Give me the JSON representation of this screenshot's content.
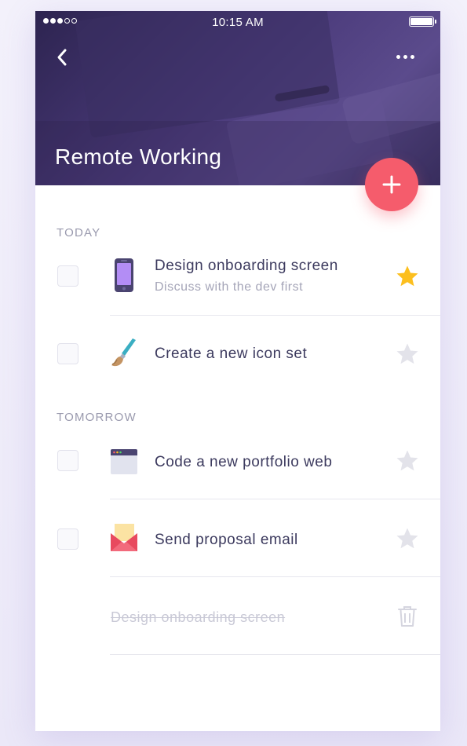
{
  "status_bar": {
    "time": "10:15 AM"
  },
  "header": {
    "title": "Remote Working"
  },
  "sections": {
    "today": "TODAY",
    "tomorrow": "TOMORROW"
  },
  "tasks": [
    {
      "title": "Design onboarding screen",
      "subtitle": "Discuss with the dev first",
      "icon": "phone-icon",
      "starred": true
    },
    {
      "title": "Create a new icon set",
      "icon": "paintbrush-icon",
      "starred": false
    },
    {
      "title": "Code a new portfolio web",
      "icon": "browser-window-icon",
      "starred": false
    },
    {
      "title": "Send proposal email",
      "icon": "envelope-icon",
      "starred": false
    }
  ],
  "completed": [
    {
      "title": "Design onboarding screen"
    }
  ],
  "colors": {
    "accent": "#f55c6c",
    "star_active": "#fcbf1e",
    "star_inactive": "#e3e3ea",
    "text_primary": "#3c3a5e",
    "text_secondary": "#a5a5b8",
    "header_overlay": "#4a3a7a"
  }
}
